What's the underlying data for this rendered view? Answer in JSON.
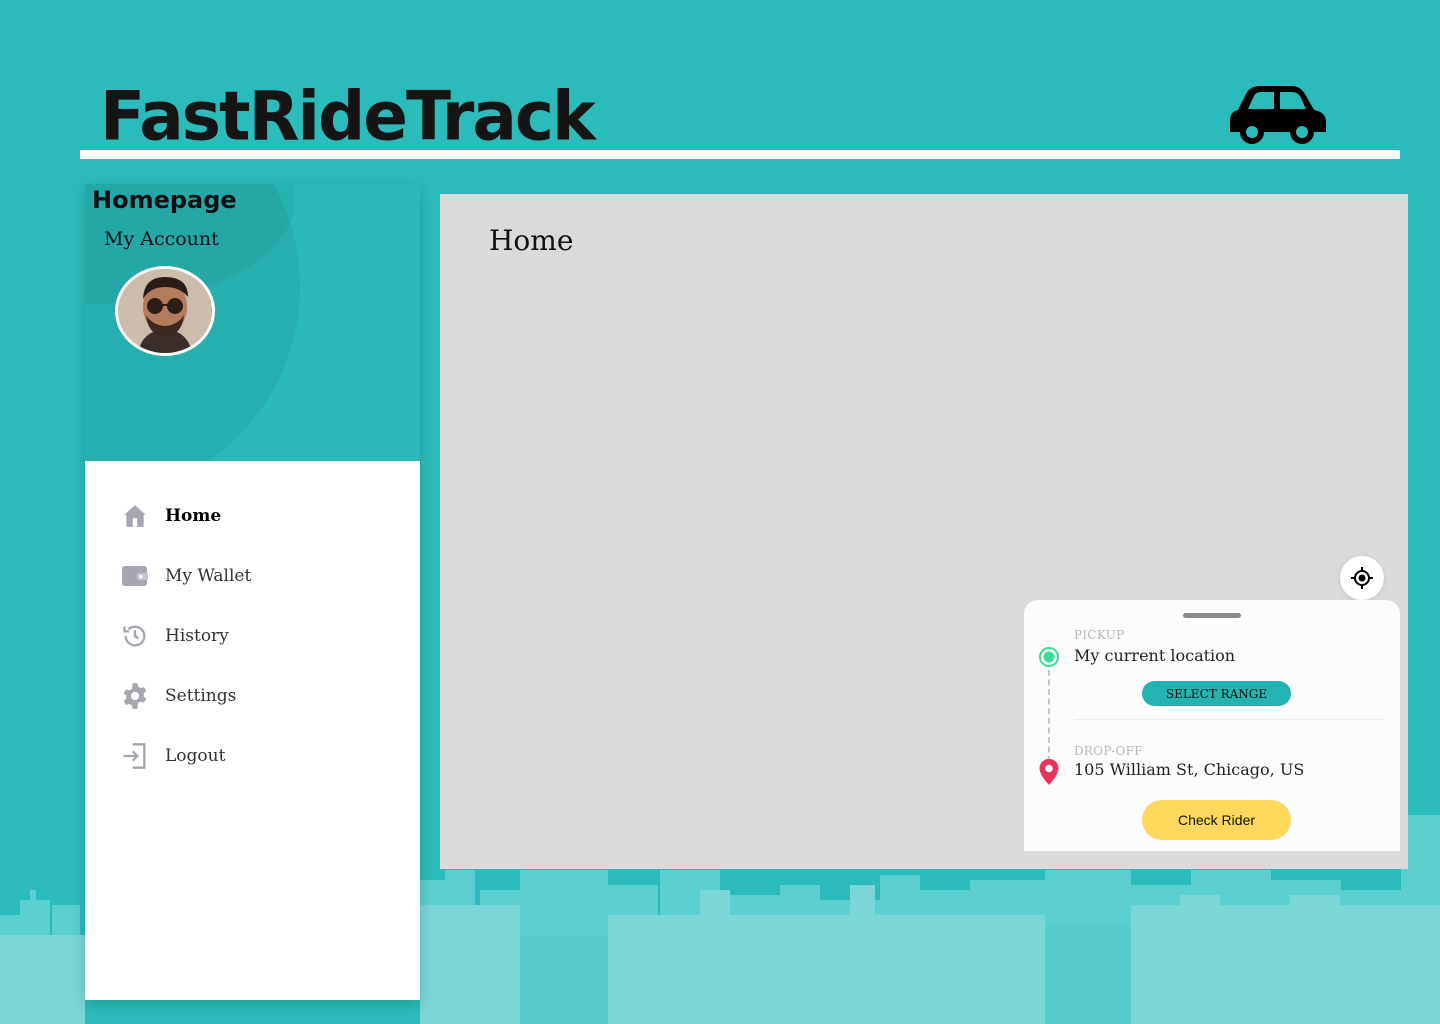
{
  "app": {
    "brand": "FastRideTrack",
    "brand_icon": "car-icon"
  },
  "colors": {
    "background": "#2bbbbb",
    "accent": "#24b3b3",
    "cta": "#fdd85d",
    "pickup": "#3ddc97",
    "dropoff": "#e8345a"
  },
  "sidebar": {
    "title": "Homepage",
    "subtitle": "My Account",
    "items": [
      {
        "label": "Home",
        "icon": "home-icon",
        "active": true
      },
      {
        "label": "My Wallet",
        "icon": "wallet-icon",
        "active": false
      },
      {
        "label": "History",
        "icon": "history-icon",
        "active": false
      },
      {
        "label": "Settings",
        "icon": "gear-icon",
        "active": false
      },
      {
        "label": "Logout",
        "icon": "logout-icon",
        "active": false
      }
    ]
  },
  "main": {
    "title": "Home",
    "locate_icon": "crosshair-icon"
  },
  "ride": {
    "pickup_label": "PICKUP",
    "pickup_value": "My current location",
    "select_range_label": "SELECT RANGE",
    "dropoff_label": "DROP-OFF",
    "dropoff_value": "105 William St, Chicago, US",
    "check_rider_label": "Check Rider"
  }
}
